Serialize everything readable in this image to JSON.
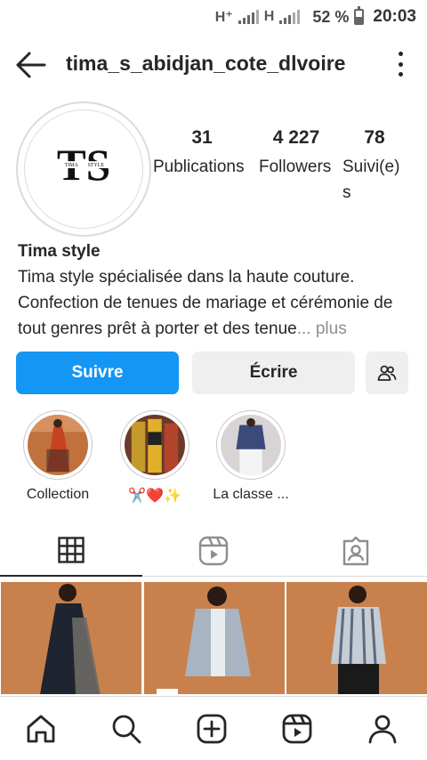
{
  "status_bar": {
    "network1": "H⁺",
    "network2": "H",
    "battery": "52 %",
    "battery_level": 0.52,
    "time": "20:03"
  },
  "header": {
    "username": "tima_s_abidjan_cote_dlvoire",
    "back_icon": "arrow-left-icon",
    "more_icon": "vertical-dots-icon"
  },
  "profile": {
    "avatar_logo_text": "TS",
    "avatar_logo_small_left": "TIMA",
    "avatar_logo_small_right": "STYLE",
    "stats": [
      {
        "value": "31",
        "label": "Publications"
      },
      {
        "value": "4 227",
        "label": "Followers"
      },
      {
        "value": "78",
        "label": "Suivi(e)s"
      }
    ],
    "name": "Tima style",
    "bio": "Tima style spécialisée dans la haute couture. Confection de tenues de mariage et cérémonie de tout genres prêt à porter et des tenue",
    "bio_ellipsis": "...",
    "bio_more": " plus"
  },
  "actions": {
    "follow": "Suivre",
    "message": "Écrire",
    "suggest_icon": "add-people-icon"
  },
  "highlights": [
    {
      "label": "Collection"
    },
    {
      "label": "✂️❤️✨"
    },
    {
      "label": "La classe ..."
    }
  ],
  "tabs": [
    {
      "icon": "grid-icon",
      "active": true
    },
    {
      "icon": "reels-icon",
      "active": false
    },
    {
      "icon": "tagged-icon",
      "active": false
    }
  ],
  "colors": {
    "accent": "#1496f5",
    "secondary_button": "#efefef",
    "text": "#262626",
    "muted": "#8e8e8e",
    "photo_background": "#c8814d"
  },
  "bottom_nav": [
    {
      "icon": "home-icon"
    },
    {
      "icon": "search-icon"
    },
    {
      "icon": "create-post-icon"
    },
    {
      "icon": "reels-icon"
    },
    {
      "icon": "profile-icon"
    }
  ]
}
